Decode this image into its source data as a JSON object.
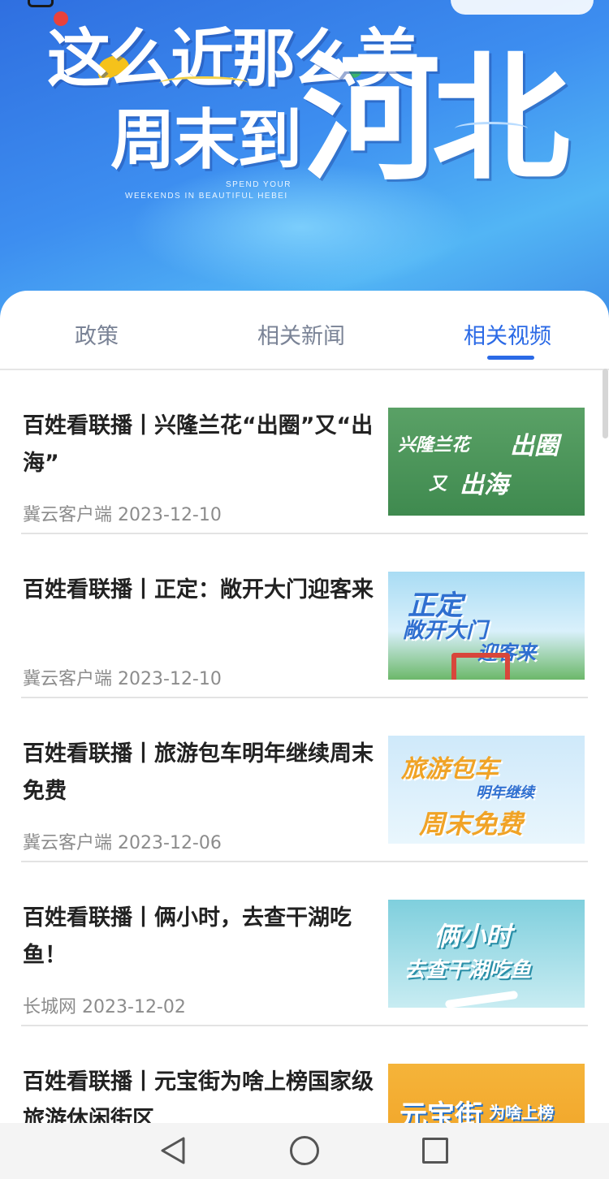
{
  "hero": {
    "line1": "这么近那么美",
    "line2": "周末到",
    "line3": "河北",
    "subtitle_1": "SPEND YOUR",
    "subtitle_2": "WEEKENDS IN BEAUTIFUL HEBEI"
  },
  "tabs": [
    {
      "label": "政策",
      "active": false
    },
    {
      "label": "相关新闻",
      "active": false
    },
    {
      "label": "相关视频",
      "active": true
    }
  ],
  "accent_color": "#2b6ae6",
  "items": [
    {
      "title": "百姓看联播丨兴隆兰花“出圈”又“出海”",
      "source": "冀云客户端",
      "date": "2023-12-10",
      "thumb_text": [
        "兴隆兰花",
        "出圈",
        "又",
        "出海"
      ]
    },
    {
      "title": "百姓看联播丨正定：敞开大门迎客来",
      "source": "冀云客户端",
      "date": "2023-12-10",
      "thumb_text": [
        "正定",
        "敞开大门",
        "迎客来"
      ]
    },
    {
      "title": "百姓看联播丨旅游包车明年继续周末免费",
      "source": "冀云客户端",
      "date": "2023-12-06",
      "thumb_text": [
        "旅游包车",
        "明年继续",
        "周末免费"
      ]
    },
    {
      "title": "百姓看联播丨俩小时，去查干湖吃鱼！",
      "source": "长城网",
      "date": "2023-12-02",
      "thumb_text": [
        "俩小时",
        "去查干湖吃鱼"
      ]
    },
    {
      "title": "百姓看联播丨元宝街为啥上榜国家级旅游休闲街区",
      "source": "",
      "date": "",
      "thumb_text": [
        "元宝街",
        "为啥上榜"
      ]
    }
  ],
  "navbar": {
    "back_icon": "triangle-back-icon",
    "home_icon": "circle-home-icon",
    "recent_icon": "square-recent-icon"
  }
}
